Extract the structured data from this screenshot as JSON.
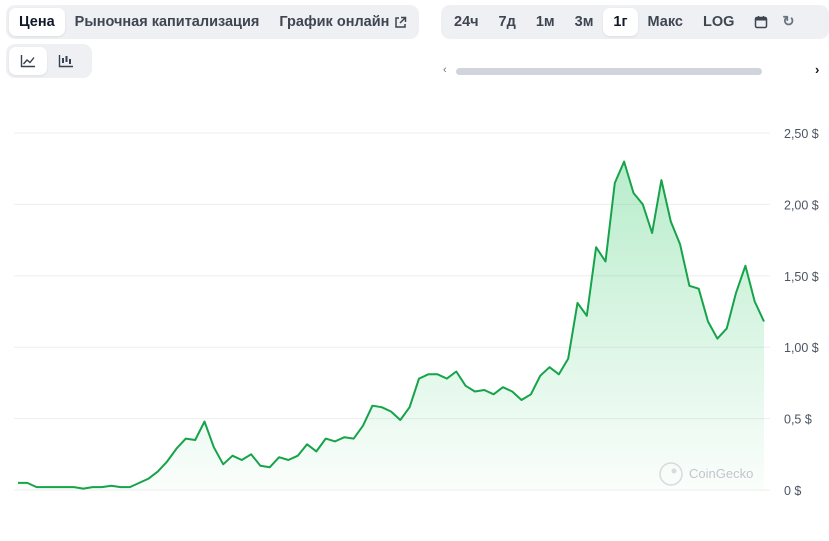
{
  "tabs": {
    "price_label": "Цена",
    "market_cap_label": "Рыночная капитализация",
    "live_chart_label": "График онлайн"
  },
  "ranges": {
    "r24h": "24ч",
    "r7d": "7д",
    "r1m": "1м",
    "r3m": "3м",
    "r1y": "1г",
    "max": "Макс",
    "log": "LOG"
  },
  "chart_type": {
    "selected": "line"
  },
  "watermark": "CoinGecko",
  "colors": {
    "line": "#16a34a",
    "fill": "#22c55e",
    "grid": "#eeeeee"
  },
  "chart_data": {
    "type": "area",
    "title": "",
    "xlabel": "",
    "ylabel": "",
    "ylim": [
      0,
      2.5
    ],
    "yticks": [
      0,
      0.5,
      1.0,
      1.5,
      2.0,
      2.5
    ],
    "ytick_labels": [
      "0 $",
      "0,5 $",
      "1,00 $",
      "1,50 $",
      "2,00 $",
      "2,50 $"
    ],
    "y_axis_position": "right",
    "grid": true,
    "series": [
      {
        "values": [
          0.05,
          0.05,
          0.02,
          0.02,
          0.02,
          0.02,
          0.02,
          0.01,
          0.02,
          0.02,
          0.03,
          0.02,
          0.02,
          0.05,
          0.08,
          0.13,
          0.2,
          0.29,
          0.36,
          0.35,
          0.48,
          0.3,
          0.18,
          0.24,
          0.21,
          0.25,
          0.17,
          0.16,
          0.23,
          0.21,
          0.24,
          0.32,
          0.27,
          0.36,
          0.34,
          0.37,
          0.36,
          0.45,
          0.59,
          0.58,
          0.55,
          0.49,
          0.58,
          0.78,
          0.81,
          0.81,
          0.78,
          0.83,
          0.73,
          0.69,
          0.7,
          0.67,
          0.72,
          0.69,
          0.63,
          0.67,
          0.8,
          0.86,
          0.81,
          0.92,
          1.31,
          1.22,
          1.7,
          1.6,
          2.15,
          2.3,
          2.08,
          2.0,
          1.8,
          2.17,
          1.88,
          1.72,
          1.43,
          1.41,
          1.18,
          1.06,
          1.13,
          1.38,
          1.57,
          1.32,
          1.18
        ]
      }
    ]
  }
}
